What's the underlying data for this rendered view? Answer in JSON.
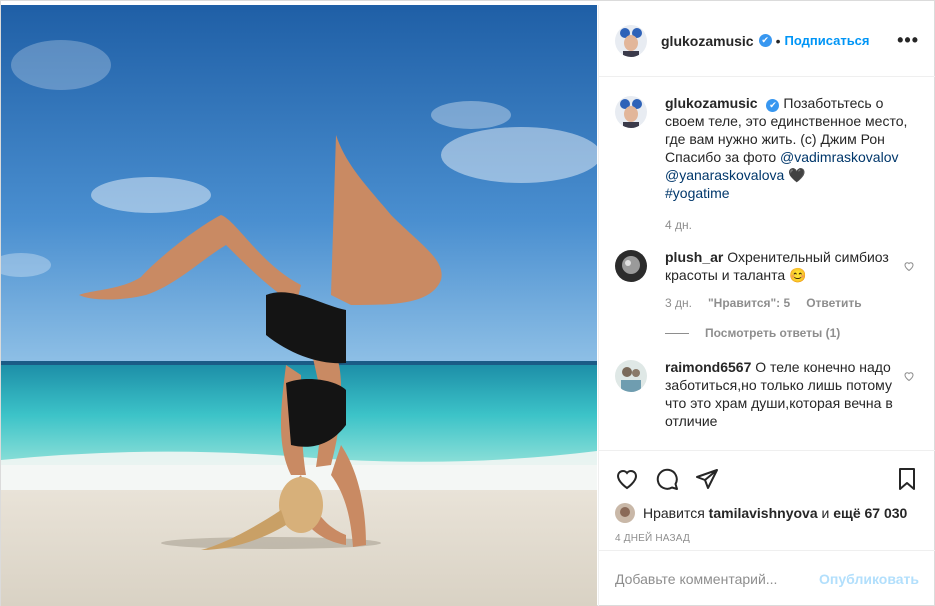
{
  "header": {
    "username": "glukozamusic",
    "verified_mark": "✔",
    "separator": "•",
    "follow_label": "Подписаться",
    "more_label": "•••"
  },
  "caption": {
    "username": "glukozamusic",
    "verified_mark": "✔",
    "text_1": "Позаботьтесь о своем теле, это единственное место, где вам нужно жить. (c) Джим Рон Спасибо за фото",
    "mention_1": "@vadimraskovalov",
    "mention_2": "@yanaraskovalova",
    "heart": "🖤",
    "hashtag": "#yogatime",
    "time": "4 дн."
  },
  "comments": [
    {
      "username": "plush_ar",
      "text": "Охренительный симбиоз красоты и таланта 😊",
      "time": "3 дн.",
      "likes": "\"Нравится\": 5",
      "reply_label": "Ответить",
      "view_replies": "Посмотреть ответы (1)"
    },
    {
      "username": "raimond6567",
      "text": "О теле конечно надо заботиться,но только лишь потому что это храм души,которая вечна в отличие"
    }
  ],
  "likes": {
    "prefix": "Нравится",
    "user": "tamilavishnyova",
    "conj": "и",
    "count": "ещё 67 030"
  },
  "post_date": "4 ДНЕЙ НАЗАД",
  "add_comment": {
    "placeholder": "Добавьте комментарий...",
    "publish_label": "Опубликовать"
  },
  "colors": {
    "accent": "#0095f6",
    "verified": "#3897f0",
    "publish_disabled": "#b2dffc"
  },
  "icons": [
    "heart-icon",
    "comment-icon",
    "share-icon",
    "bookmark-icon",
    "more-icon",
    "verified-icon"
  ]
}
